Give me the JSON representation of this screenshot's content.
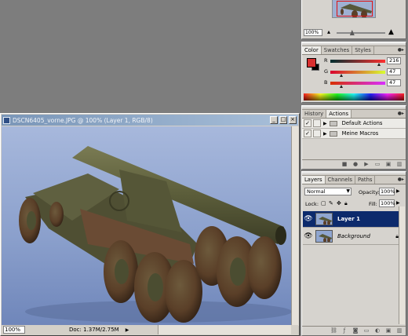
{
  "document": {
    "title": "DSCN6405_vorne.JPG @ 100% (Layer 1, RGB/8)",
    "zoom": "100%",
    "info": "Doc: 1.37M/2.75M",
    "controls": {
      "minimize": "_",
      "maximize": "□",
      "close": "×"
    }
  },
  "navigator": {
    "zoom": "100%",
    "zoom_level": 0.3
  },
  "color": {
    "tabs": [
      "Color",
      "Swatches",
      "Styles"
    ],
    "foreground": "#d82f2f",
    "background": "#000000",
    "channels": [
      {
        "label": "R",
        "value": "216"
      },
      {
        "label": "G",
        "value": "47"
      },
      {
        "label": "B",
        "value": "47"
      }
    ]
  },
  "history": {
    "tabs": [
      "History",
      "Actions"
    ],
    "actions": [
      {
        "label": "Default Actions",
        "checked": true
      },
      {
        "label": "Meine Macros",
        "checked": true
      }
    ]
  },
  "layers": {
    "tabs": [
      "Layers",
      "Channels",
      "Paths"
    ],
    "blend_mode": "Normal",
    "opacity_label": "Opacity:",
    "opacity": "100%",
    "lock_label": "Lock:",
    "fill_label": "Fill:",
    "fill": "100%",
    "items": [
      {
        "name": "Layer 1",
        "selected": true
      },
      {
        "name": "Background",
        "selected": false,
        "locked": true
      }
    ]
  },
  "colors": {
    "accent": "#0c2a6c",
    "panel": "#d6d3ce",
    "canvas_bg": "#7d7d7d"
  }
}
